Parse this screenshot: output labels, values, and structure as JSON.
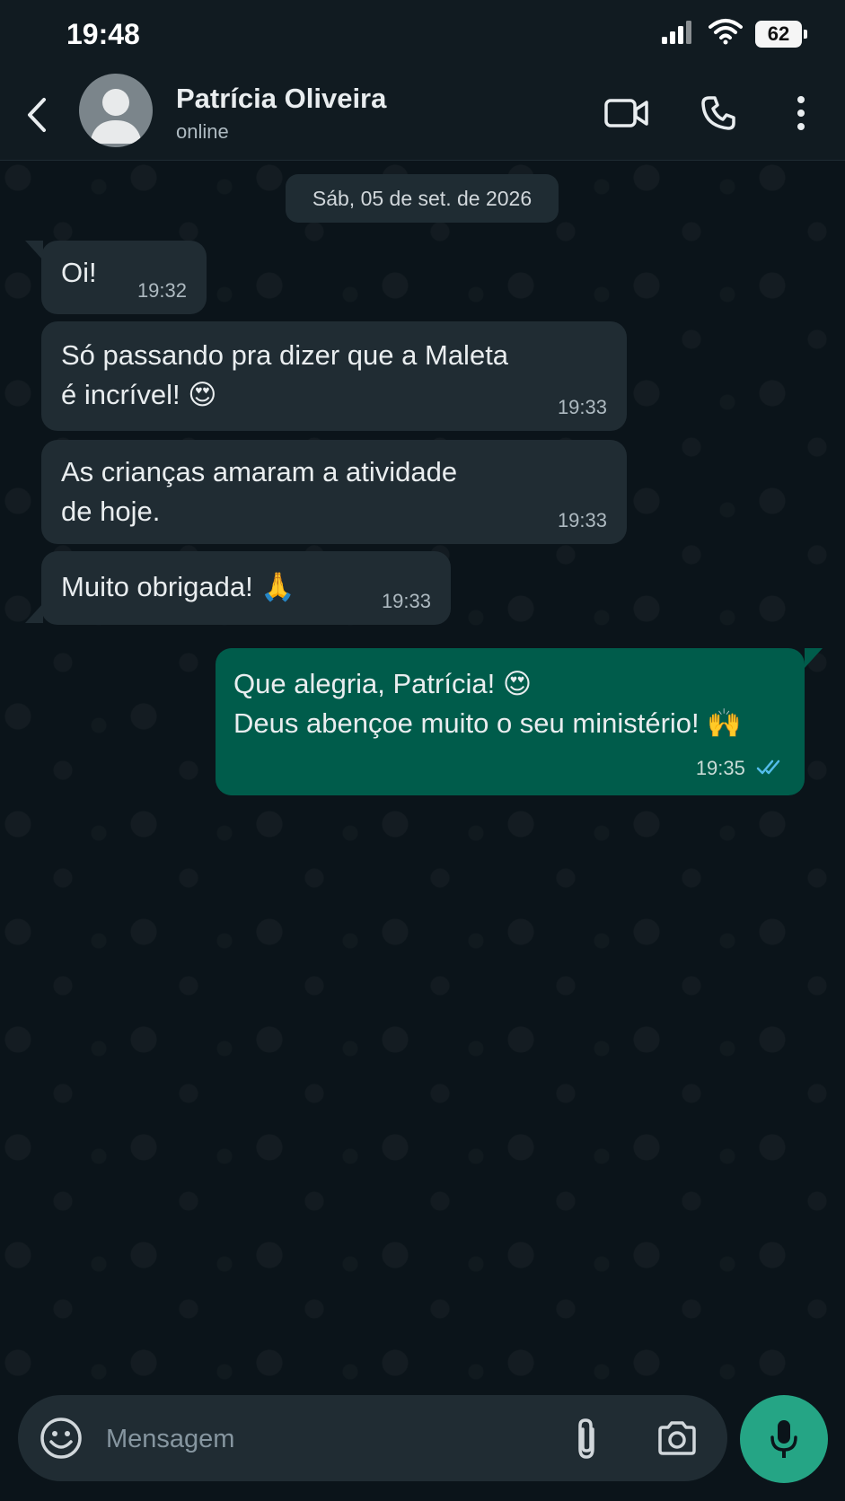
{
  "status_bar": {
    "time": "19:48",
    "battery": "62"
  },
  "header": {
    "name": "Patrícia Oliveira",
    "status": "online"
  },
  "chat": {
    "date_chip": "Sáb, 05 de set. de 2026",
    "messages": [
      {
        "dir": "in",
        "text": "Oi!",
        "time": "19:32"
      },
      {
        "dir": "in",
        "text": "Só passando pra dizer que a Maleta\né incrível! 😍",
        "time": "19:33"
      },
      {
        "dir": "in",
        "text": "As crianças amaram a atividade\nde hoje.",
        "time": "19:33"
      },
      {
        "dir": "in",
        "text": "Muito obrigada! 🙏",
        "time": "19:33"
      },
      {
        "dir": "out",
        "text": "Que alegria, Patrícia! 😍\nDeus abençoe muito o seu ministério! 🙌",
        "time": "19:35",
        "status": "read"
      }
    ]
  },
  "input": {
    "placeholder": "Mensagem"
  },
  "colors": {
    "accent": "#25a585",
    "outgoing_bubble": "#005c4b",
    "incoming_bubble": "#202c33",
    "read_ticks": "#53bdeb"
  }
}
